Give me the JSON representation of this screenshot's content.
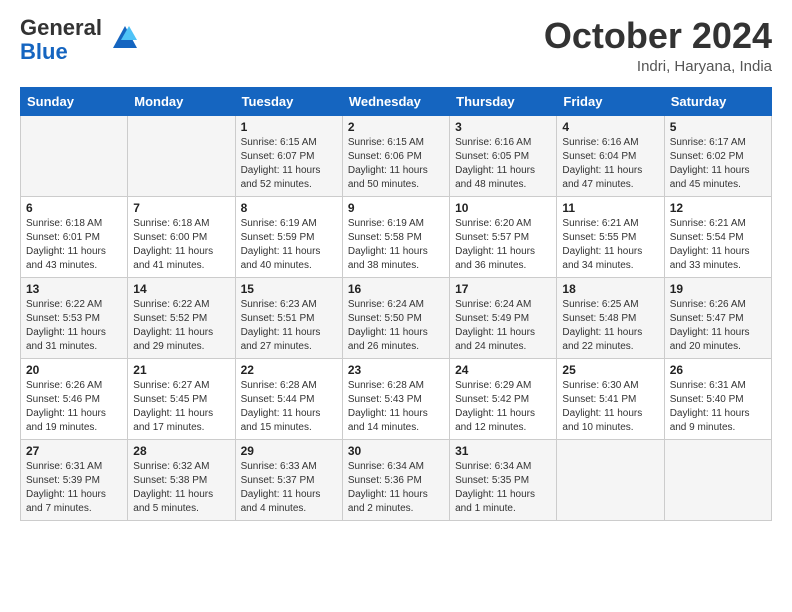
{
  "header": {
    "logo_general": "General",
    "logo_blue": "Blue",
    "title": "October 2024",
    "location": "Indri, Haryana, India"
  },
  "columns": [
    "Sunday",
    "Monday",
    "Tuesday",
    "Wednesday",
    "Thursday",
    "Friday",
    "Saturday"
  ],
  "weeks": [
    [
      {
        "day": "",
        "info": ""
      },
      {
        "day": "",
        "info": ""
      },
      {
        "day": "1",
        "info": "Sunrise: 6:15 AM\nSunset: 6:07 PM\nDaylight: 11 hours and 52 minutes."
      },
      {
        "day": "2",
        "info": "Sunrise: 6:15 AM\nSunset: 6:06 PM\nDaylight: 11 hours and 50 minutes."
      },
      {
        "day": "3",
        "info": "Sunrise: 6:16 AM\nSunset: 6:05 PM\nDaylight: 11 hours and 48 minutes."
      },
      {
        "day": "4",
        "info": "Sunrise: 6:16 AM\nSunset: 6:04 PM\nDaylight: 11 hours and 47 minutes."
      },
      {
        "day": "5",
        "info": "Sunrise: 6:17 AM\nSunset: 6:02 PM\nDaylight: 11 hours and 45 minutes."
      }
    ],
    [
      {
        "day": "6",
        "info": "Sunrise: 6:18 AM\nSunset: 6:01 PM\nDaylight: 11 hours and 43 minutes."
      },
      {
        "day": "7",
        "info": "Sunrise: 6:18 AM\nSunset: 6:00 PM\nDaylight: 11 hours and 41 minutes."
      },
      {
        "day": "8",
        "info": "Sunrise: 6:19 AM\nSunset: 5:59 PM\nDaylight: 11 hours and 40 minutes."
      },
      {
        "day": "9",
        "info": "Sunrise: 6:19 AM\nSunset: 5:58 PM\nDaylight: 11 hours and 38 minutes."
      },
      {
        "day": "10",
        "info": "Sunrise: 6:20 AM\nSunset: 5:57 PM\nDaylight: 11 hours and 36 minutes."
      },
      {
        "day": "11",
        "info": "Sunrise: 6:21 AM\nSunset: 5:55 PM\nDaylight: 11 hours and 34 minutes."
      },
      {
        "day": "12",
        "info": "Sunrise: 6:21 AM\nSunset: 5:54 PM\nDaylight: 11 hours and 33 minutes."
      }
    ],
    [
      {
        "day": "13",
        "info": "Sunrise: 6:22 AM\nSunset: 5:53 PM\nDaylight: 11 hours and 31 minutes."
      },
      {
        "day": "14",
        "info": "Sunrise: 6:22 AM\nSunset: 5:52 PM\nDaylight: 11 hours and 29 minutes."
      },
      {
        "day": "15",
        "info": "Sunrise: 6:23 AM\nSunset: 5:51 PM\nDaylight: 11 hours and 27 minutes."
      },
      {
        "day": "16",
        "info": "Sunrise: 6:24 AM\nSunset: 5:50 PM\nDaylight: 11 hours and 26 minutes."
      },
      {
        "day": "17",
        "info": "Sunrise: 6:24 AM\nSunset: 5:49 PM\nDaylight: 11 hours and 24 minutes."
      },
      {
        "day": "18",
        "info": "Sunrise: 6:25 AM\nSunset: 5:48 PM\nDaylight: 11 hours and 22 minutes."
      },
      {
        "day": "19",
        "info": "Sunrise: 6:26 AM\nSunset: 5:47 PM\nDaylight: 11 hours and 20 minutes."
      }
    ],
    [
      {
        "day": "20",
        "info": "Sunrise: 6:26 AM\nSunset: 5:46 PM\nDaylight: 11 hours and 19 minutes."
      },
      {
        "day": "21",
        "info": "Sunrise: 6:27 AM\nSunset: 5:45 PM\nDaylight: 11 hours and 17 minutes."
      },
      {
        "day": "22",
        "info": "Sunrise: 6:28 AM\nSunset: 5:44 PM\nDaylight: 11 hours and 15 minutes."
      },
      {
        "day": "23",
        "info": "Sunrise: 6:28 AM\nSunset: 5:43 PM\nDaylight: 11 hours and 14 minutes."
      },
      {
        "day": "24",
        "info": "Sunrise: 6:29 AM\nSunset: 5:42 PM\nDaylight: 11 hours and 12 minutes."
      },
      {
        "day": "25",
        "info": "Sunrise: 6:30 AM\nSunset: 5:41 PM\nDaylight: 11 hours and 10 minutes."
      },
      {
        "day": "26",
        "info": "Sunrise: 6:31 AM\nSunset: 5:40 PM\nDaylight: 11 hours and 9 minutes."
      }
    ],
    [
      {
        "day": "27",
        "info": "Sunrise: 6:31 AM\nSunset: 5:39 PM\nDaylight: 11 hours and 7 minutes."
      },
      {
        "day": "28",
        "info": "Sunrise: 6:32 AM\nSunset: 5:38 PM\nDaylight: 11 hours and 5 minutes."
      },
      {
        "day": "29",
        "info": "Sunrise: 6:33 AM\nSunset: 5:37 PM\nDaylight: 11 hours and 4 minutes."
      },
      {
        "day": "30",
        "info": "Sunrise: 6:34 AM\nSunset: 5:36 PM\nDaylight: 11 hours and 2 minutes."
      },
      {
        "day": "31",
        "info": "Sunrise: 6:34 AM\nSunset: 5:35 PM\nDaylight: 11 hours and 1 minute."
      },
      {
        "day": "",
        "info": ""
      },
      {
        "day": "",
        "info": ""
      }
    ]
  ]
}
